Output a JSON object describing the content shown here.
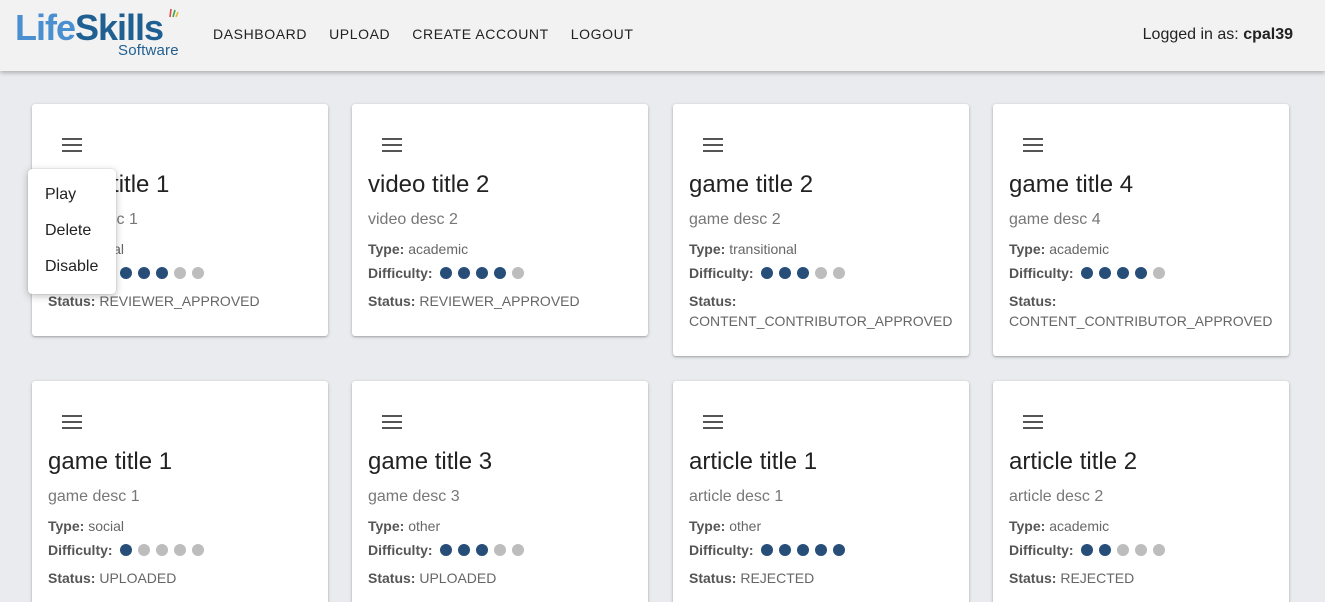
{
  "header": {
    "logo": {
      "part1": "Life",
      "part2": "Skills",
      "sub": "Software"
    },
    "nav": [
      "DASHBOARD",
      "UPLOAD",
      "CREATE ACCOUNT",
      "LOGOUT"
    ],
    "user_label": "Logged in as:",
    "username": "cpal39"
  },
  "labels": {
    "type": "Type:",
    "difficulty": "Difficulty:",
    "status": "Status:"
  },
  "popup_menu": [
    "Play",
    "Delete",
    "Disable"
  ],
  "cards": [
    {
      "title": "video title 1",
      "desc": "video desc 1",
      "type": "social",
      "difficulty": 3,
      "status": "REVIEWER_APPROVED"
    },
    {
      "title": "video title 2",
      "desc": "video desc 2",
      "type": "academic",
      "difficulty": 4,
      "status": "REVIEWER_APPROVED"
    },
    {
      "title": "game title 2",
      "desc": "game desc 2",
      "type": "transitional",
      "difficulty": 3,
      "status": "CONTENT_CONTRIBUTOR_APPROVED"
    },
    {
      "title": "game title 4",
      "desc": "game desc 4",
      "type": "academic",
      "difficulty": 4,
      "status": "CONTENT_CONTRIBUTOR_APPROVED"
    },
    {
      "title": "game title 1",
      "desc": "game desc 1",
      "type": "social",
      "difficulty": 1,
      "status": "UPLOADED"
    },
    {
      "title": "game title 3",
      "desc": "game desc 3",
      "type": "other",
      "difficulty": 3,
      "status": "UPLOADED"
    },
    {
      "title": "article title 1",
      "desc": "article desc 1",
      "type": "other",
      "difficulty": 5,
      "status": "REJECTED"
    },
    {
      "title": "article title 2",
      "desc": "article desc 2",
      "type": "academic",
      "difficulty": 2,
      "status": "REJECTED"
    }
  ],
  "difficulty_max": 5,
  "colors": {
    "dot_on": "#264e79",
    "dot_off": "#bdbdbd",
    "background": "#e9ebee"
  }
}
